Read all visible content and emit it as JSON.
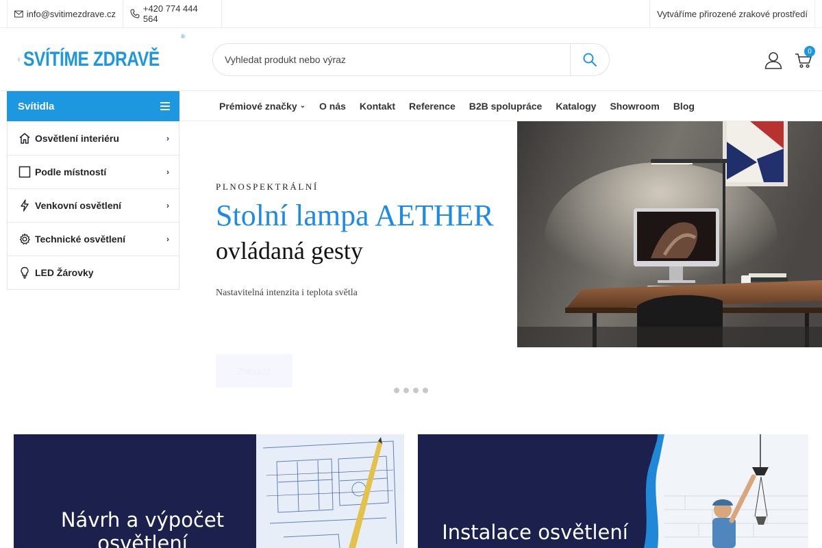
{
  "topbar": {
    "email": "info@svitimezdrave.cz",
    "phone": "+420 774 444 564",
    "tagline": "Vytváříme přirozené zrakové prostředí"
  },
  "header": {
    "logo_text": "SVÍTÍME ZDRAVĚ",
    "logo_mark": "®",
    "search_placeholder": "Vyhledat produkt nebo výraz",
    "cart_count": "0"
  },
  "category_menu": {
    "title": "Svítidla",
    "items": [
      {
        "label": "Osvětlení interiéru",
        "icon": "home-icon",
        "has_arrow": true
      },
      {
        "label": "Podle místností",
        "icon": "square-icon",
        "has_arrow": true
      },
      {
        "label": "Venkovní osvětlení",
        "icon": "bolt-icon",
        "has_arrow": true
      },
      {
        "label": "Technické osvětlení",
        "icon": "gear-icon",
        "has_arrow": true
      },
      {
        "label": "LED Žárovky",
        "icon": "bulb-icon",
        "has_arrow": false
      }
    ]
  },
  "nav": {
    "items": [
      {
        "label": "Prémiové značky",
        "dropdown": true
      },
      {
        "label": "O nás"
      },
      {
        "label": "Kontakt"
      },
      {
        "label": "Reference"
      },
      {
        "label": "B2B spolupráce"
      },
      {
        "label": "Katalogy"
      },
      {
        "label": "Showroom"
      },
      {
        "label": "Blog"
      }
    ]
  },
  "hero": {
    "subtitle": "PLNOSPEKTRÁLNÍ",
    "title": "Stolní lampa AETHER",
    "title2": "ovládaná gesty",
    "description": "Nastavitelná intenzita i teplota světla",
    "button_label": "Zobrazit",
    "slide_count": 4
  },
  "banners": [
    {
      "line1": "Návrh a výpočet",
      "line2": "osvětlení"
    },
    {
      "line1": "Instalace osvětlení",
      "line2": ""
    }
  ],
  "colors": {
    "accent": "#1d97e0",
    "hero_title": "#1d8ae8",
    "banner_bg": "#1b214c"
  }
}
